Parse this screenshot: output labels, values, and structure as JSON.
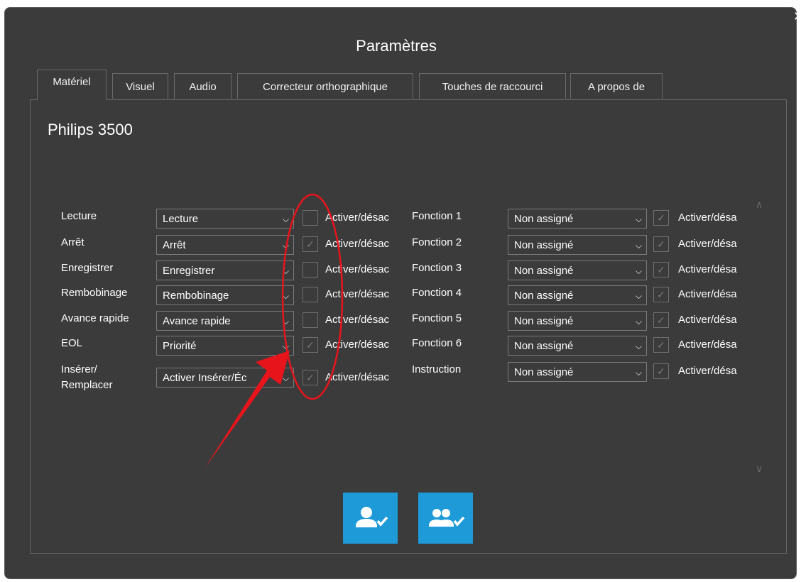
{
  "dialog": {
    "title": "Paramètres",
    "close_glyph": "✕"
  },
  "tabs": [
    {
      "label": "Matériel",
      "active": true
    },
    {
      "label": "Visuel"
    },
    {
      "label": "Audio"
    },
    {
      "label": "Correcteur orthographique"
    },
    {
      "label": "Touches de raccourci"
    },
    {
      "label": "A propos de"
    }
  ],
  "device_name": "Philips 3500",
  "left_rows": [
    {
      "label": "Lecture",
      "value": "Lecture",
      "checked": false,
      "toggle": "Activer/désac"
    },
    {
      "label": "Arrêt",
      "value": "Arrêt",
      "checked": true,
      "toggle": "Activer/désac"
    },
    {
      "label": "Enregistrer",
      "value": "Enregistrer",
      "checked": false,
      "toggle": "Activer/désac"
    },
    {
      "label": "Rembobinage",
      "value": "Rembobinage",
      "checked": false,
      "toggle": "Activer/désac"
    },
    {
      "label": "Avance rapide",
      "value": "Avance rapide",
      "checked": false,
      "toggle": "Activer/désac"
    },
    {
      "label": "EOL",
      "value": "Priorité",
      "checked": true,
      "toggle": "Activer/désac"
    },
    {
      "label_line1": "Insérer/",
      "label_line2": "Remplacer",
      "value": "Activer Insérer/Éc",
      "checked": true,
      "toggle": "Activer/désac"
    }
  ],
  "right_rows": [
    {
      "label": "Fonction 1",
      "value": "Non assigné",
      "checked": true,
      "toggle": "Activer/désa"
    },
    {
      "label": "Fonction 2",
      "value": "Non assigné",
      "checked": true,
      "toggle": "Activer/désa"
    },
    {
      "label": "Fonction 3",
      "value": "Non assigné",
      "checked": true,
      "toggle": "Activer/désa"
    },
    {
      "label": "Fonction 4",
      "value": "Non assigné",
      "checked": true,
      "toggle": "Activer/désa"
    },
    {
      "label": "Fonction 5",
      "value": "Non assigné",
      "checked": true,
      "toggle": "Activer/désa"
    },
    {
      "label": "Fonction 6",
      "value": "Non assigné",
      "checked": true,
      "toggle": "Activer/désa"
    },
    {
      "label": "Instruction",
      "value": "Non assigné",
      "checked": true,
      "toggle": "Activer/désa"
    }
  ],
  "buttons": [
    {
      "icon": "user-check-icon"
    },
    {
      "icon": "users-check-icon"
    }
  ],
  "colors": {
    "background": "#3b3b3b",
    "accent": "#1e9ad8",
    "annotation": "#e8141c"
  }
}
